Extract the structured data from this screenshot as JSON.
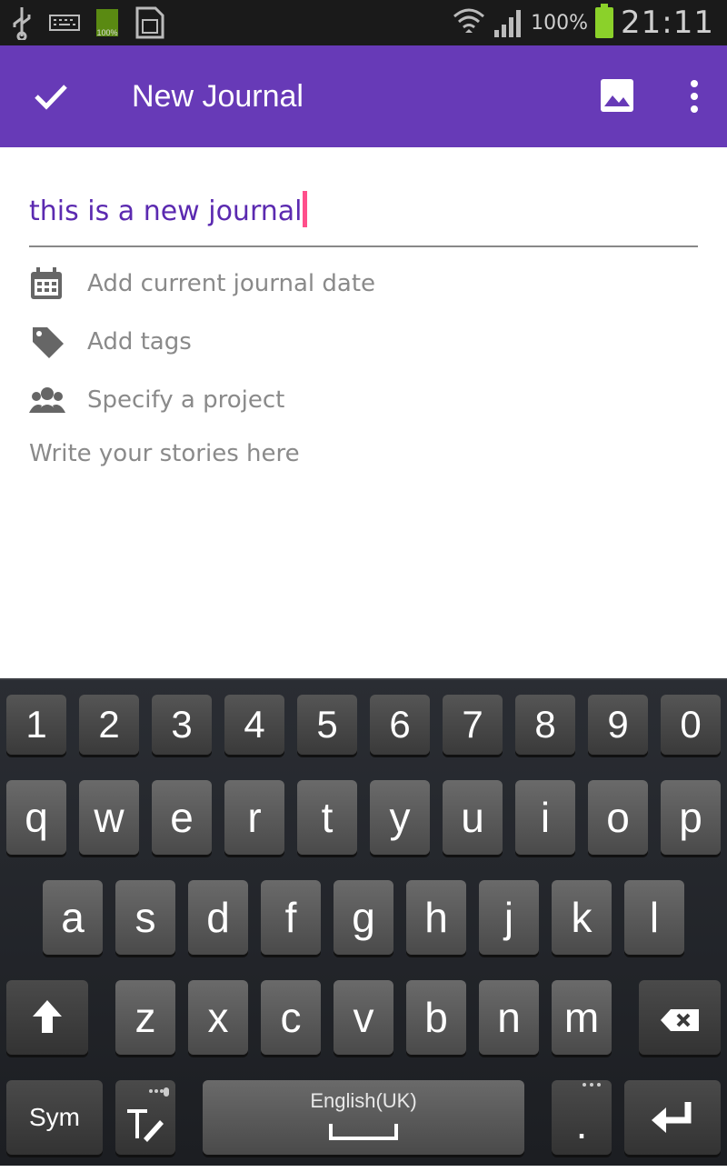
{
  "status": {
    "battery_percent": "100%",
    "time": "21:11",
    "small_battery_label": "100%"
  },
  "appbar": {
    "title": "New Journal"
  },
  "editor": {
    "title_value": "this is a new journal",
    "rows": [
      {
        "label": "Add current journal date",
        "icon": "calendar-icon"
      },
      {
        "label": "Add tags",
        "icon": "tag-icon"
      },
      {
        "label": "Specify a project",
        "icon": "people-icon"
      }
    ],
    "story_placeholder": "Write your stories here"
  },
  "keyboard": {
    "numbers": [
      "1",
      "2",
      "3",
      "4",
      "5",
      "6",
      "7",
      "8",
      "9",
      "0"
    ],
    "row1": [
      "q",
      "w",
      "e",
      "r",
      "t",
      "y",
      "u",
      "i",
      "o",
      "p"
    ],
    "row2": [
      "a",
      "s",
      "d",
      "f",
      "g",
      "h",
      "j",
      "k",
      "l"
    ],
    "row3": [
      "z",
      "x",
      "c",
      "v",
      "b",
      "n",
      "m"
    ],
    "sym": "Sym",
    "space_label": "English(UK)",
    "period": "."
  },
  "colors": {
    "accent": "#673ab7",
    "title_text": "#5b2ab0",
    "caret": "#ff4f8b"
  }
}
